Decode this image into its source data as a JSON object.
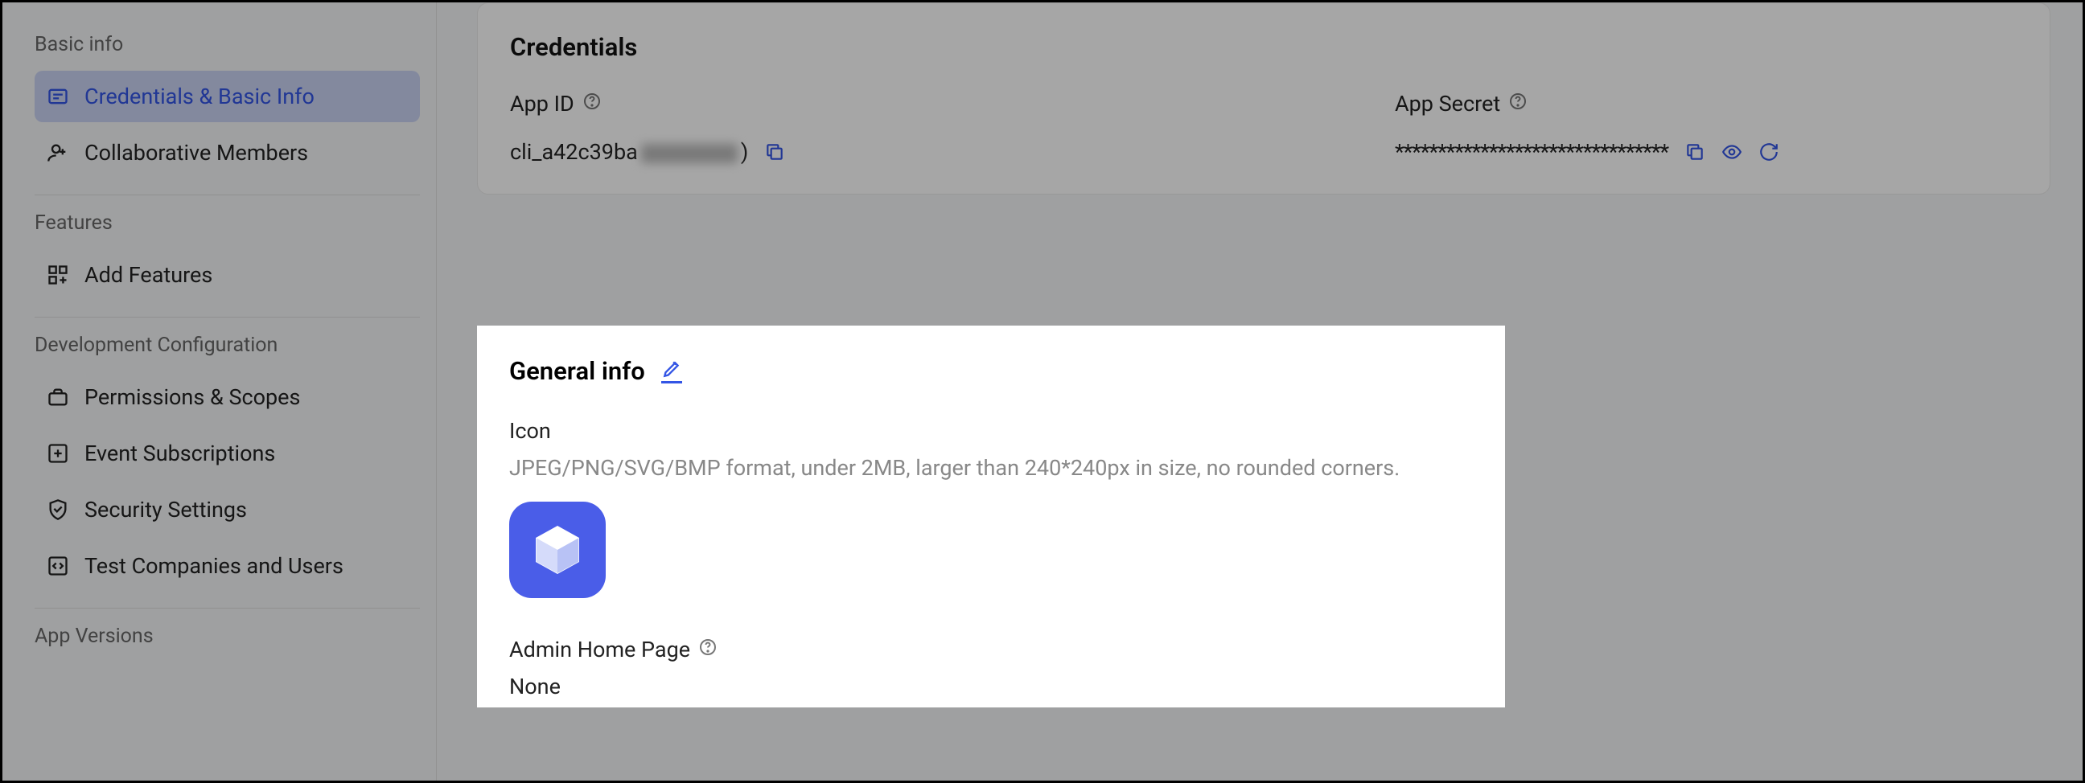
{
  "sidebar": {
    "sections": {
      "basic_info": {
        "title": "Basic info",
        "items": {
          "credentials": "Credentials & Basic Info",
          "collaborative": "Collaborative Members"
        }
      },
      "features": {
        "title": "Features",
        "items": {
          "add_features": "Add Features"
        }
      },
      "dev_config": {
        "title": "Development Configuration",
        "items": {
          "permissions": "Permissions & Scopes",
          "events": "Event Subscriptions",
          "security": "Security Settings",
          "test_companies": "Test Companies and Users"
        }
      },
      "app_versions": {
        "title": "App Versions"
      }
    }
  },
  "credentials": {
    "title": "Credentials",
    "app_id_label": "App ID",
    "app_id_prefix": "cli_a42c39ba",
    "app_id_suffix": ")",
    "app_secret_label": "App Secret",
    "app_secret_value": "********************************"
  },
  "general": {
    "title": "General info",
    "icon_label": "Icon",
    "icon_desc": "JPEG/PNG/SVG/BMP format, under 2MB, larger than 240*240px in size, no rounded corners.",
    "admin_label": "Admin Home Page",
    "admin_value": "None"
  }
}
